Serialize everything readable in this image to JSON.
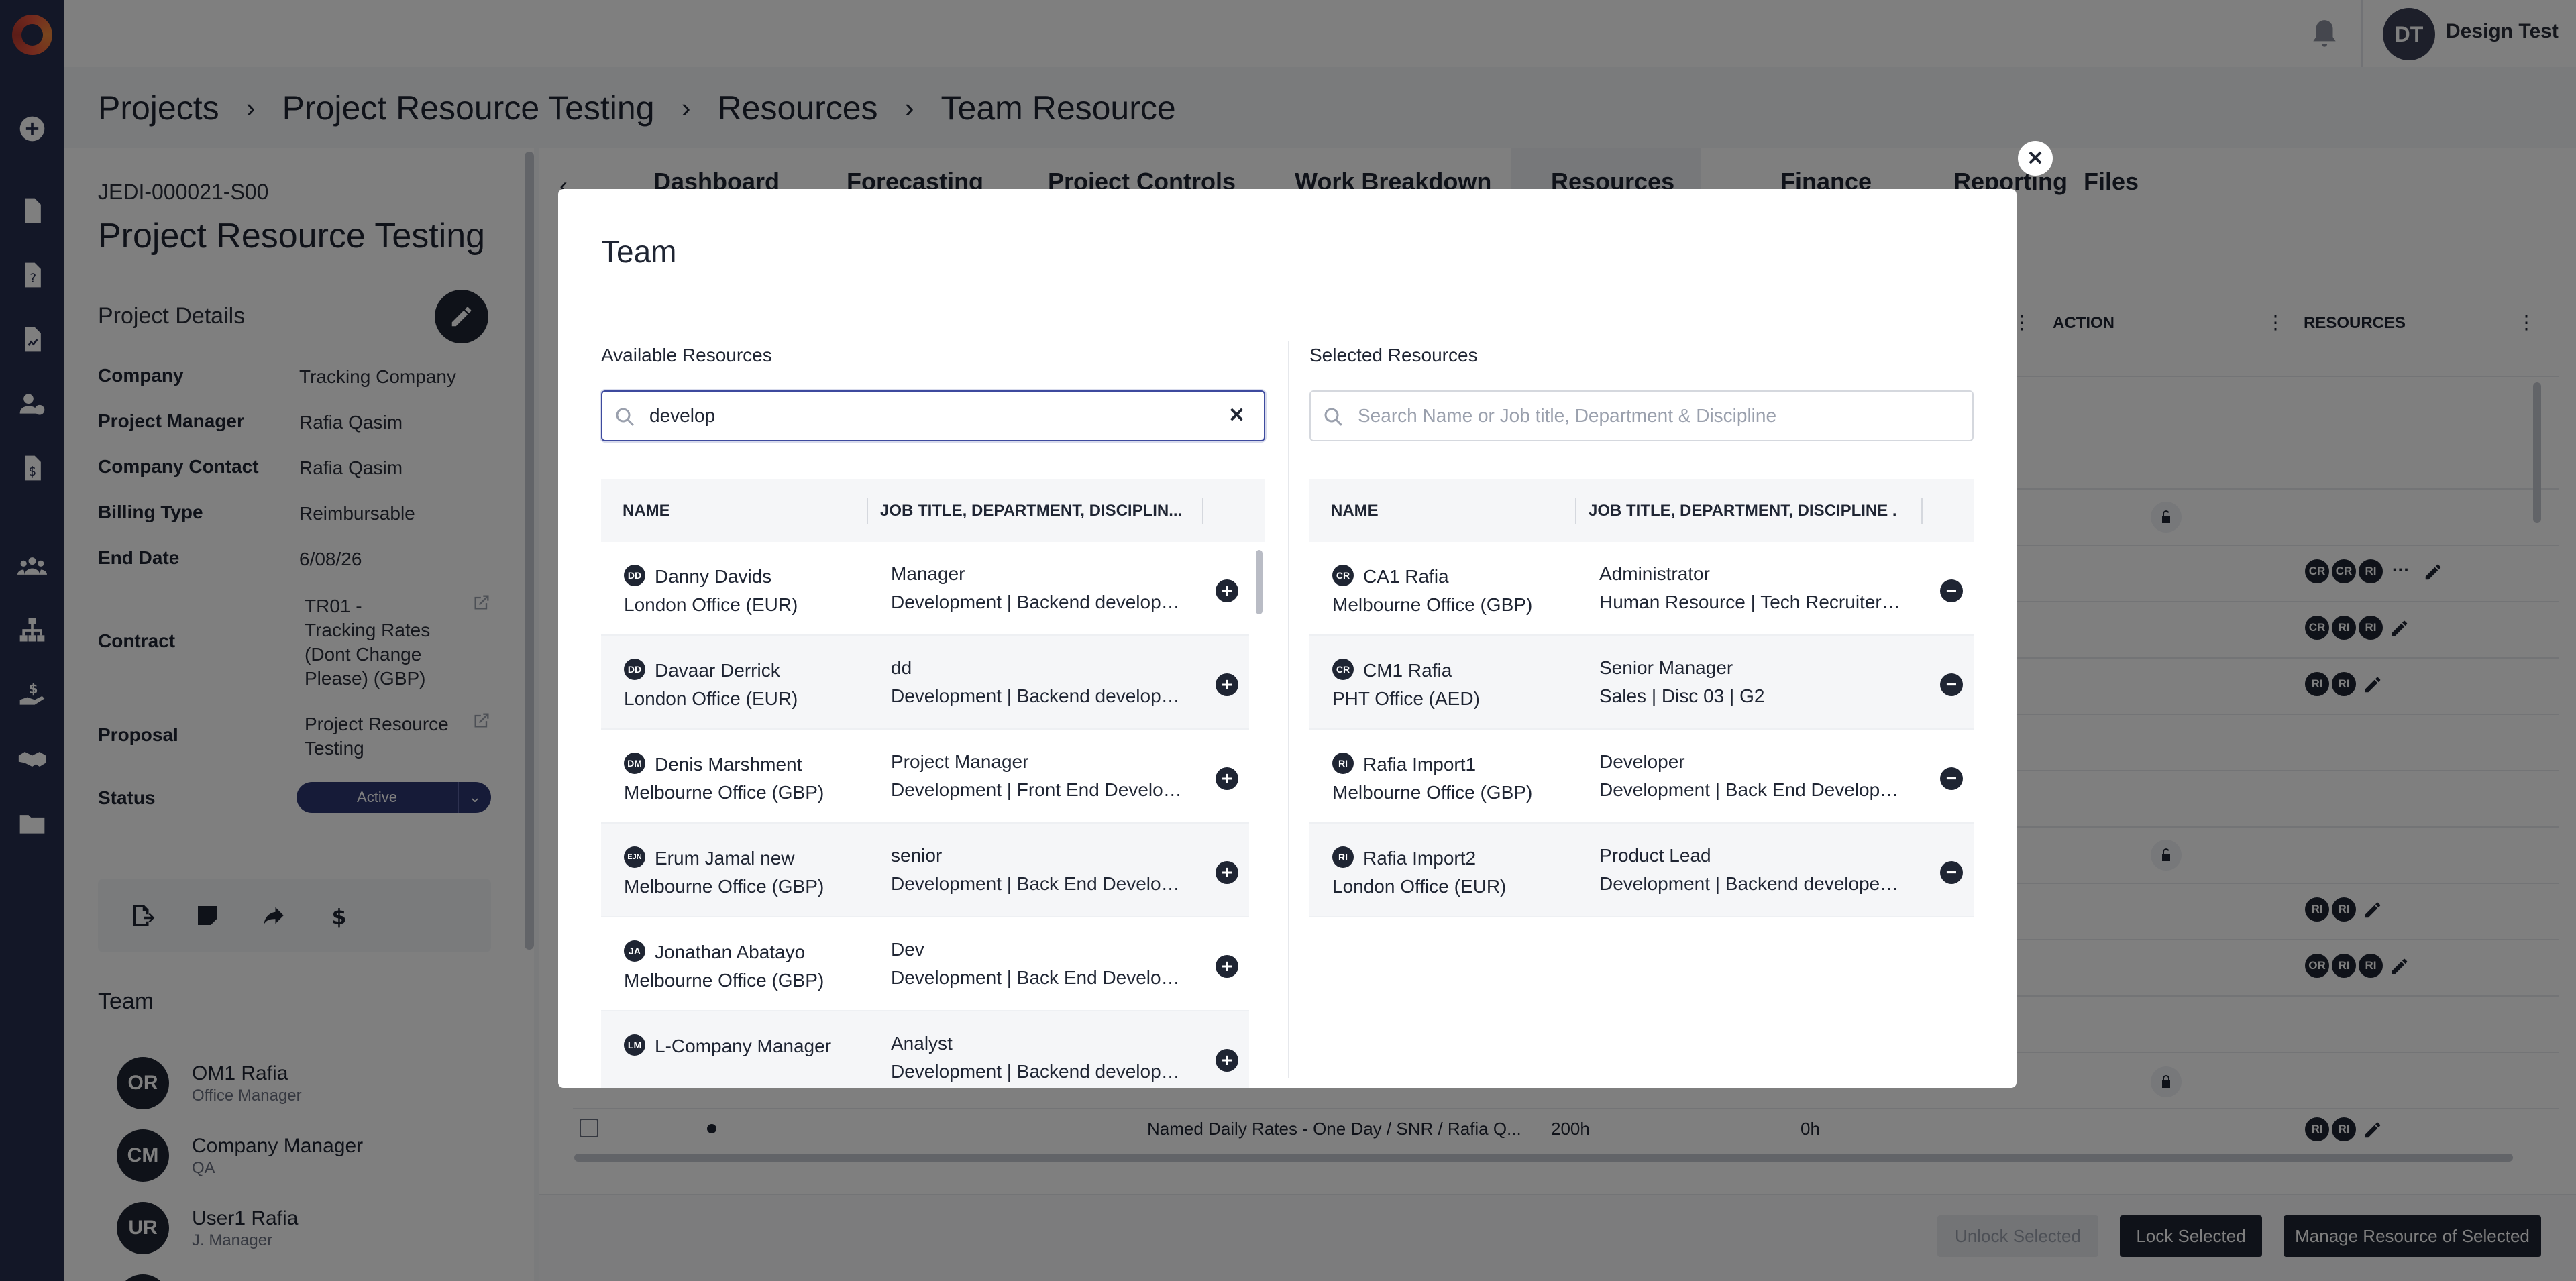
{
  "rail": {
    "icons": [
      "logo",
      "add-icon",
      "document-icon",
      "help-document-icon",
      "report-document-icon",
      "user-clock-icon",
      "invoice-icon",
      "team-icon",
      "org-chart-icon",
      "money-hand-icon",
      "handshake-icon",
      "folder-icon"
    ]
  },
  "topbar": {
    "avatar_initials": "DT",
    "user_name": "Design Test"
  },
  "breadcrumb": [
    "Projects",
    "Project Resource Testing",
    "Resources",
    "Team Resource"
  ],
  "project": {
    "code": "JEDI-000021-S00",
    "title": "Project Resource Testing",
    "details_heading": "Project Details",
    "fields": [
      {
        "label": "Company",
        "value": "Tracking Company"
      },
      {
        "label": "Project Manager",
        "value": "Rafia Qasim"
      },
      {
        "label": "Company Contact",
        "value": "Rafia Qasim"
      },
      {
        "label": "Billing Type",
        "value": "Reimbursable"
      },
      {
        "label": "End Date",
        "value": "6/08/26"
      },
      {
        "label": "Contract",
        "value": "TR01 - Tracking Rates (Dont Change Please) (GBP)"
      },
      {
        "label": "Proposal",
        "value": "Project Resource Testing"
      },
      {
        "label": "Status",
        "value": "Active"
      }
    ],
    "team_heading": "Team",
    "team": [
      {
        "initials": "OR",
        "name": "OM1 Rafia",
        "role": "Office Manager"
      },
      {
        "initials": "CM",
        "name": "Company Manager",
        "role": "QA"
      },
      {
        "initials": "UR",
        "name": "User1 Rafia",
        "role": "J. Manager"
      }
    ]
  },
  "tabs": [
    "Dashboard",
    "Forecasting",
    "Project Controls",
    "Work Breakdown",
    "Resources",
    "Finance",
    "Reporting",
    "Files"
  ],
  "active_tab": "Resources",
  "grid": {
    "headers": {
      "action": "ACTION",
      "resources": "RESOURCES"
    },
    "chip_rows": [
      [
        "CR",
        "CR",
        "RI"
      ],
      [
        "CR",
        "RI",
        "RI"
      ],
      [
        "RI",
        "RI"
      ],
      [
        "RI",
        "RI"
      ],
      [
        "OR",
        "RI",
        "RI"
      ],
      [
        "RI",
        "RI"
      ]
    ],
    "last_row": {
      "text": "Named Daily Rates - One Day / SNR / Rafia Q...",
      "hours": "200h",
      "hours2": "0h"
    }
  },
  "footer": {
    "unlock": "Unlock Selected",
    "lock": "Lock Selected",
    "manage": "Manage Resource of Selected"
  },
  "modal": {
    "title": "Team",
    "available": {
      "heading": "Available Resources",
      "search_value": "develop",
      "columns": [
        "NAME",
        "JOB TITLE, DEPARTMENT, DISCIPLIN..."
      ],
      "rows": [
        {
          "initials": "DD",
          "name": "Danny Davids",
          "office": "London Office (EUR)",
          "job": "Manager",
          "dept": "Development | Backend developer..."
        },
        {
          "initials": "DD",
          "name": "Davaar Derrick",
          "office": "London Office (EUR)",
          "job": "dd",
          "dept": "Development | Backend developer..."
        },
        {
          "initials": "DM",
          "name": "Denis Marshment",
          "office": "Melbourne Office (GBP)",
          "job": "Project Manager",
          "dept": "Development | Front End Develop..."
        },
        {
          "initials": "EJN",
          "name": "Erum Jamal new",
          "office": "Melbourne Office (GBP)",
          "job": "senior",
          "dept": "Development | Back End Develop..."
        },
        {
          "initials": "JA",
          "name": "Jonathan Abatayo",
          "office": "Melbourne Office (GBP)",
          "job": "Dev",
          "dept": "Development | Back End Develop..."
        },
        {
          "initials": "LM",
          "name": "L-Company Manager",
          "office": "",
          "job": "Analyst",
          "dept": "Development | Backend developer..."
        }
      ]
    },
    "selected": {
      "heading": "Selected Resources",
      "search_placeholder": "Search Name or Job title, Department & Discipline",
      "columns": [
        "NAME",
        "JOB TITLE, DEPARTMENT, DISCIPLINE ..."
      ],
      "rows": [
        {
          "initials": "CR",
          "name": "CA1 Rafia",
          "office": "Melbourne Office (GBP)",
          "job": "Administrator",
          "dept": "Human Resource | Tech Recruiter | ..."
        },
        {
          "initials": "CR",
          "name": "CM1 Rafia",
          "office": "PHT Office (AED)",
          "job": "Senior Manager",
          "dept": "Sales | Disc 03 | G2"
        },
        {
          "initials": "RI",
          "name": "Rafia Import1",
          "office": "Melbourne Office (GBP)",
          "job": "Developer",
          "dept": "Development | Back End Developme..."
        },
        {
          "initials": "RI",
          "name": "Rafia Import2",
          "office": "London Office (EUR)",
          "job": "Product Lead",
          "dept": "Development | Backend developer | ..."
        }
      ]
    }
  }
}
